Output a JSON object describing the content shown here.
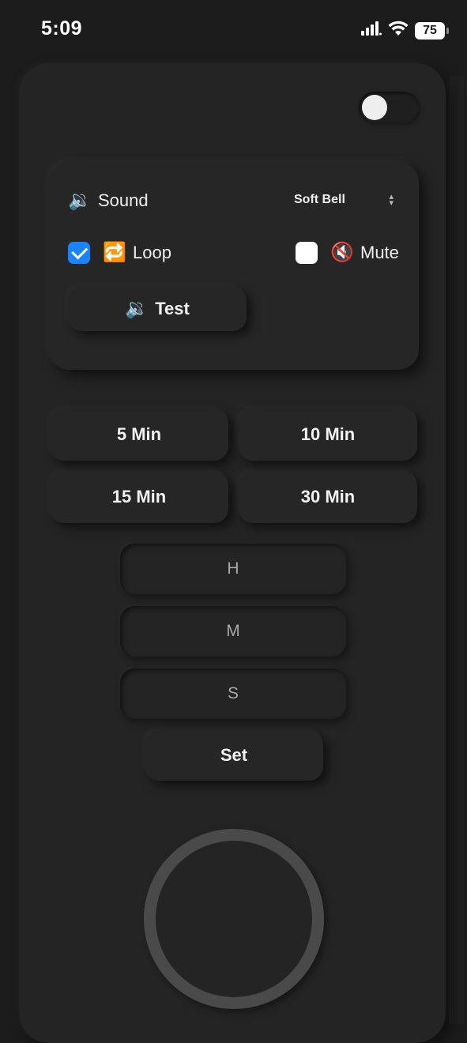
{
  "status_bar": {
    "time": "5:09",
    "battery": "75",
    "icons": [
      "cellular-icon",
      "wifi-icon",
      "battery-icon"
    ]
  },
  "theme_toggle": {
    "state": "off"
  },
  "sound_panel": {
    "sound_label": "Sound",
    "sound_emoji": "🔉",
    "selected_sound": "Soft Bell",
    "loop": {
      "label": "Loop",
      "emoji": "🔁",
      "checked": true
    },
    "mute": {
      "label": "Mute",
      "emoji": "🔇",
      "checked": false
    },
    "test_button": {
      "label": "Test",
      "emoji": "🔉"
    }
  },
  "presets": [
    {
      "label": "5 Min"
    },
    {
      "label": "10 Min"
    },
    {
      "label": "15 Min"
    },
    {
      "label": "30 Min"
    }
  ],
  "time_inputs": {
    "hours_placeholder": "H",
    "minutes_placeholder": "M",
    "seconds_placeholder": "S"
  },
  "set_button": {
    "label": "Set"
  },
  "colors": {
    "background": "#1c1c1c",
    "card": "#262626",
    "accent": "#1a84ff",
    "ring": "#4a4a4a"
  }
}
